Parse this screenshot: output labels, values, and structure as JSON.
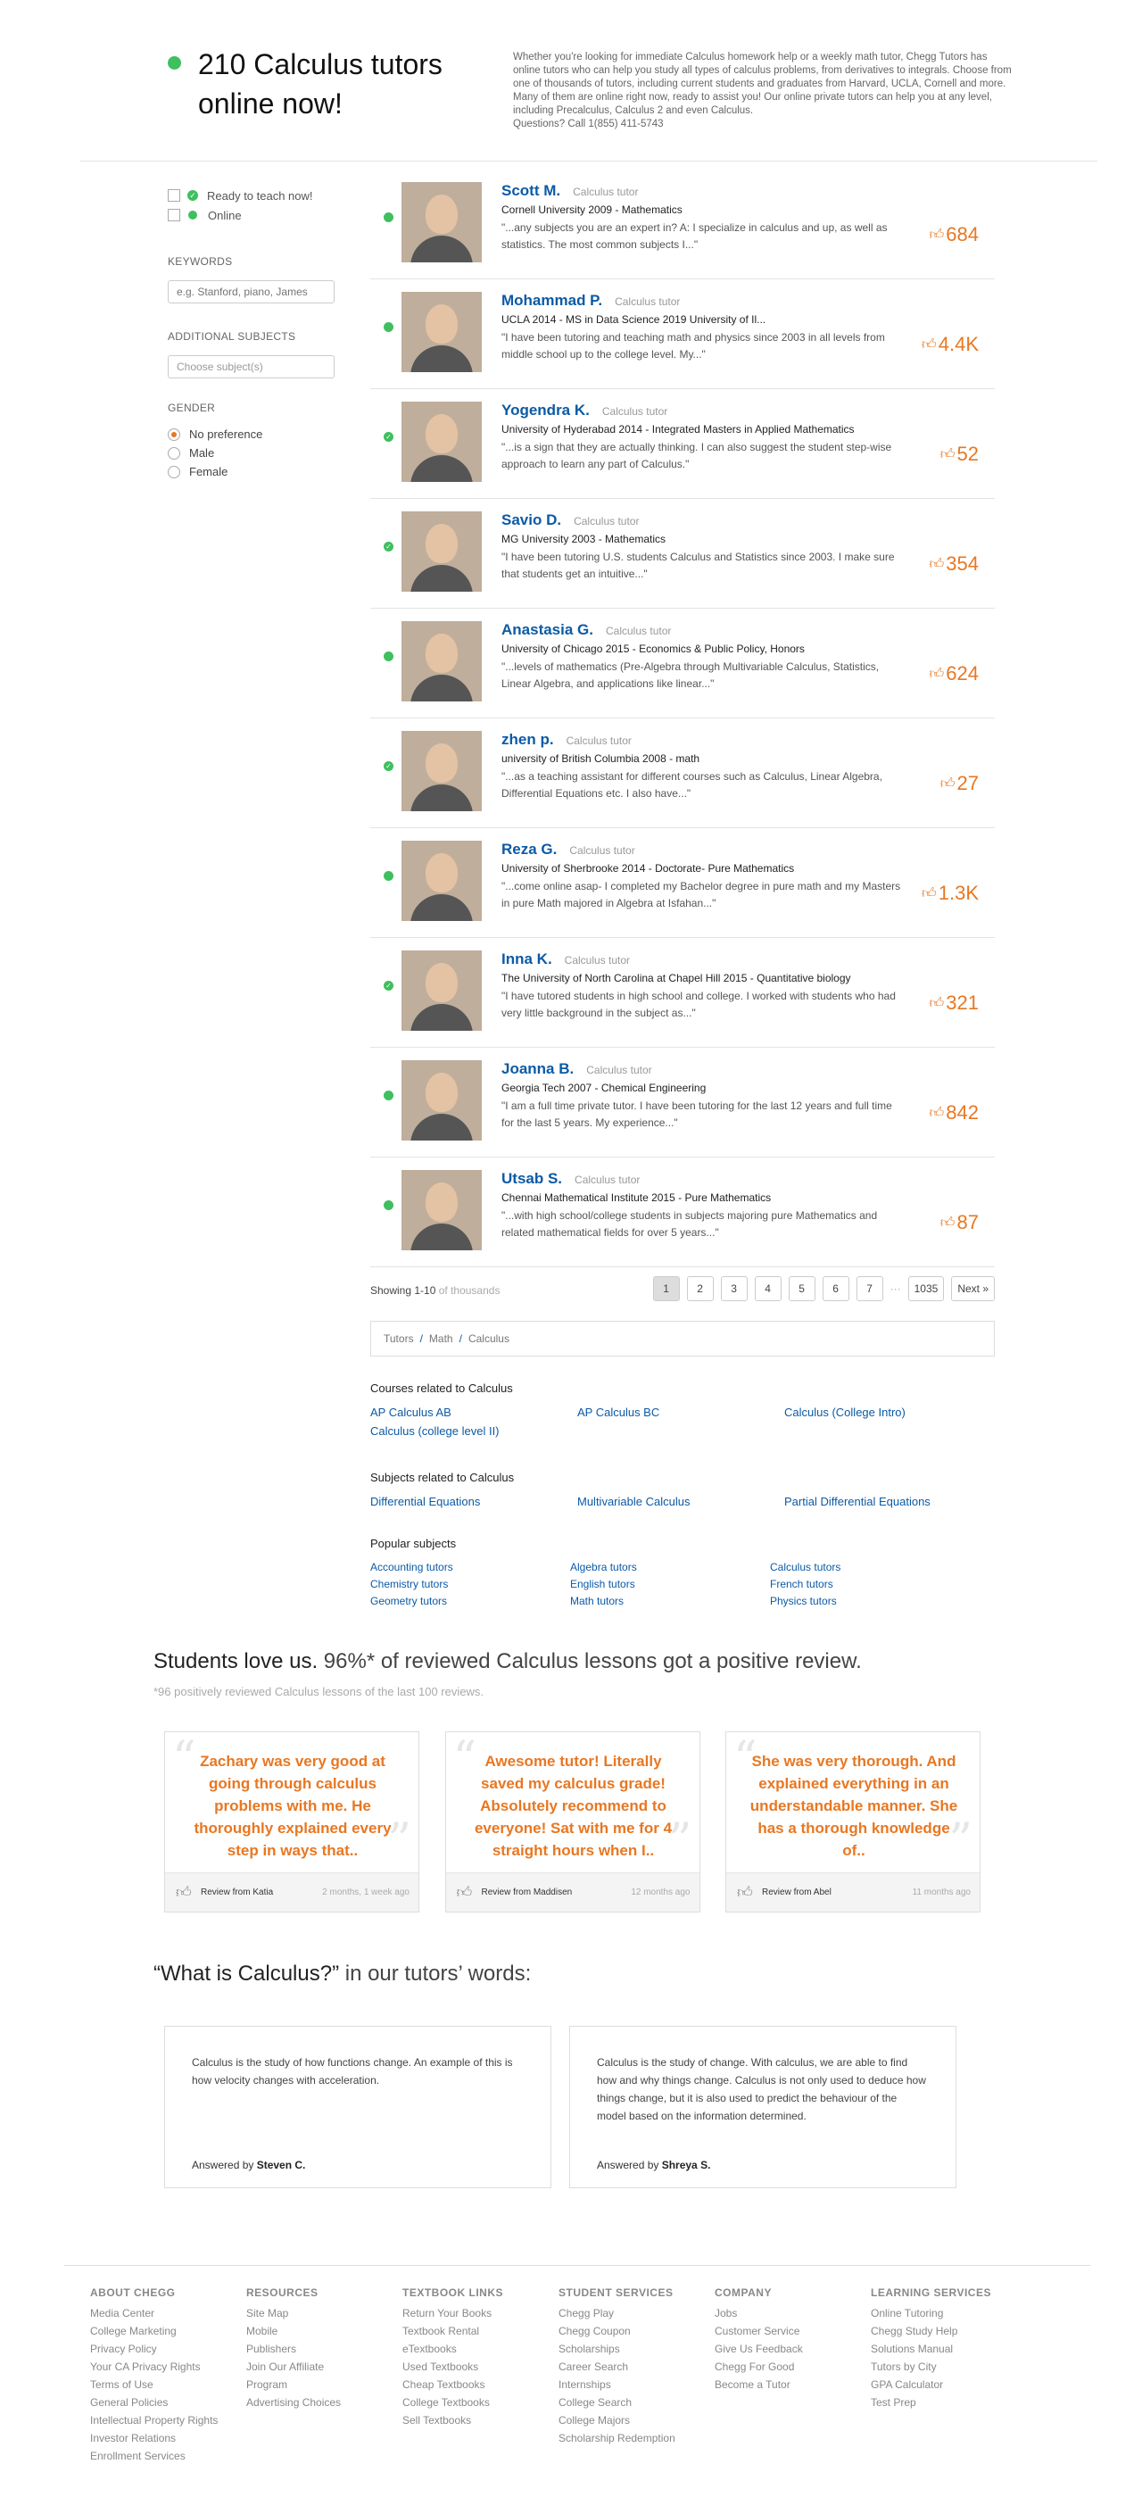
{
  "header": {
    "title": "210 Calculus tutors online now!",
    "intro": "Whether you're looking for immediate Calculus homework help or a weekly math tutor, Chegg Tutors has online tutors who can help you study all types of calculus problems, from derivatives to integrals. Choose from one of thousands of tutors, including current students and graduates from Harvard, UCLA, Cornell and more. Many of them are online right now, ready to assist you! Our online private tutors can help you at any level, including Precalculus, Calculus 2 and even Calculus.",
    "phone": "Questions? Call 1(855) 411-5743"
  },
  "filters": {
    "ready_label": "Ready to teach now!",
    "online_label": "Online",
    "keywords_label": "KEYWORDS",
    "keywords_placeholder": "e.g. Stanford, piano, James",
    "subjects_label": "ADDITIONAL SUBJECTS",
    "subjects_placeholder": "Choose subject(s)",
    "gender_label": "GENDER",
    "gender_options": [
      "No preference",
      "Male",
      "Female"
    ]
  },
  "tutors": [
    {
      "name": "Scott M.",
      "role": "Calculus tutor",
      "school": "Cornell University 2009 - Mathematics",
      "snippet": "\"...any subjects you are an expert in? A: I specialize in calculus and up, as well as statistics. The most common subjects I...\"",
      "likes": "684",
      "status": "online"
    },
    {
      "name": "Mohammad P.",
      "role": "Calculus tutor",
      "school": "UCLA 2014 - MS in Data Science 2019 University of Il...",
      "snippet": "\"I have been tutoring and teaching math and physics since 2003 in all levels from middle school up to the college level. My...\"",
      "likes": "4.4K",
      "status": "online"
    },
    {
      "name": "Yogendra K.",
      "role": "Calculus tutor",
      "school": "University of Hyderabad 2014 - Integrated Masters in Applied Mathematics",
      "snippet": "\"...is a sign that they are actually thinking. I can also suggest the student step-wise approach to learn any part of Calculus.\"",
      "likes": "52",
      "status": "ready"
    },
    {
      "name": "Savio D.",
      "role": "Calculus tutor",
      "school": "MG University 2003 - Mathematics",
      "snippet": "\"I have been tutoring U.S. students Calculus and Statistics since 2003. I make sure that students get an intuitive...\"",
      "likes": "354",
      "status": "ready"
    },
    {
      "name": "Anastasia G.",
      "role": "Calculus tutor",
      "school": "University of Chicago 2015 - Economics & Public Policy, Honors",
      "snippet": "\"...levels of mathematics (Pre-Algebra through Multivariable Calculus, Statistics, Linear Algebra, and applications like linear...\"",
      "likes": "624",
      "status": "online"
    },
    {
      "name": "zhen p.",
      "role": "Calculus tutor",
      "school": "university of British Columbia 2008 - math",
      "snippet": "\"...as a teaching assistant for different courses such as Calculus, Linear Algebra, Differential Equations etc.  I also have...\"",
      "likes": "27",
      "status": "ready"
    },
    {
      "name": "Reza G.",
      "role": "Calculus tutor",
      "school": "University of Sherbrooke 2014 - Doctorate- Pure Mathematics",
      "snippet": "\"...come online asap- I completed my Bachelor degree in pure math and my Masters in pure Math majored in Algebra at Isfahan...\"",
      "likes": "1.3K",
      "status": "online"
    },
    {
      "name": "Inna K.",
      "role": "Calculus tutor",
      "school": "The University of North Carolina at Chapel Hill 2015 - Quantitative biology",
      "snippet": "\"I have tutored students in high school and college. I worked with students who had very little background in the subject as...\"",
      "likes": "321",
      "status": "ready"
    },
    {
      "name": "Joanna B.",
      "role": "Calculus tutor",
      "school": "Georgia Tech 2007 - Chemical Engineering",
      "snippet": "\"I am a full time private tutor. I have been tutoring for the last 12 years and full time for the last 5 years. My experience...\"",
      "likes": "842",
      "status": "online"
    },
    {
      "name": "Utsab S.",
      "role": "Calculus tutor",
      "school": "Chennai Mathematical Institute 2015 - Pure Mathematics",
      "snippet": "\"...with high school/college students in subjects majoring pure Mathematics and related mathematical fields for over 5 years...\"",
      "likes": "87",
      "status": "online"
    }
  ],
  "pagination": {
    "showing": "Showing 1-10",
    "of": "of thousands",
    "pages": [
      "1",
      "2",
      "3",
      "4",
      "5",
      "6",
      "7"
    ],
    "dots": "···",
    "last": "1035",
    "next": "Next »"
  },
  "breadcrumb": [
    "Tutors",
    "Math",
    "Calculus"
  ],
  "courses": {
    "title": "Courses related to Calculus",
    "items": [
      "AP Calculus AB",
      "AP Calculus BC",
      "Calculus (College Intro)",
      "Calculus (college level II)"
    ]
  },
  "subjects": {
    "title": "Subjects related to Calculus",
    "items": [
      "Differential Equations",
      "Multivariable Calculus",
      "Partial Differential Equations"
    ]
  },
  "popular": {
    "title": "Popular subjects",
    "items": [
      "Accounting tutors",
      "Algebra tutors",
      "Calculus tutors",
      "Chemistry tutors",
      "English tutors",
      "French tutors",
      "Geometry tutors",
      "Math tutors",
      "Physics tutors"
    ]
  },
  "love": {
    "lead": "Students love us.",
    "rest": " 96%* of reviewed Calculus lessons got a positive review.",
    "note": "*96 positively reviewed Calculus lessons of the last 100 reviews."
  },
  "reviews": [
    {
      "quote": "Zachary was very good at going through calculus problems with me. He thoroughly explained every step in ways that..",
      "by": "Review from Katia",
      "when": "2 months, 1 week ago"
    },
    {
      "quote": "Awesome tutor! Literally saved my calculus grade! Absolutely recommend to everyone! Sat with me for 4 straight hours when I..",
      "by": "Review from Maddisen",
      "when": "12 months ago"
    },
    {
      "quote": "She was very thorough. And explained everything in an understandable manner. She has a thorough knowledge of..",
      "by": "Review from Abel",
      "when": "11 months ago"
    }
  ],
  "what": {
    "lead": "“What is Calculus?”",
    "rest": " in our tutors’ words:"
  },
  "answers": [
    {
      "text": "Calculus is the study of how functions change. An example of this is how velocity changes with acceleration.",
      "prefix": "Answered by ",
      "author": "Steven C."
    },
    {
      "text": "Calculus is the study of change. With calculus, we are able to find how and why things change. Calculus is not only used to deduce how things change, but it is also used to predict the behaviour of the model based on the information determined.",
      "prefix": "Answered by ",
      "author": "Shreya S."
    }
  ],
  "footer": [
    {
      "title": "ABOUT CHEGG",
      "links": [
        "Media Center",
        "College Marketing",
        "Privacy Policy",
        "Your CA Privacy Rights",
        "Terms of Use",
        "General Policies",
        "Intellectual Property Rights",
        "Investor Relations",
        "Enrollment Services"
      ]
    },
    {
      "title": "RESOURCES",
      "links": [
        "Site Map",
        "Mobile",
        "Publishers",
        "Join Our Affiliate",
        "Program",
        "Advertising Choices"
      ]
    },
    {
      "title": "TEXTBOOK LINKS",
      "links": [
        "Return Your Books",
        "Textbook Rental",
        "eTextbooks",
        "Used Textbooks",
        "Cheap Textbooks",
        "College Textbooks",
        "Sell Textbooks"
      ]
    },
    {
      "title": "STUDENT SERVICES",
      "links": [
        "Chegg Play",
        "Chegg Coupon",
        "Scholarships",
        "Career Search",
        "Internships",
        "College Search",
        "College Majors",
        "Scholarship Redemption"
      ]
    },
    {
      "title": "COMPANY",
      "links": [
        "Jobs",
        "Customer Service",
        "Give Us Feedback",
        "Chegg For Good",
        "Become a Tutor"
      ]
    },
    {
      "title": "LEARNING SERVICES",
      "links": [
        "Online Tutoring",
        "Chegg Study Help",
        "Solutions Manual",
        "Tutors by City",
        "GPA Calculator",
        "Test Prep"
      ]
    }
  ],
  "colors": {
    "accent": "#e87722",
    "link": "#0b5aa6",
    "online": "#3fbf5f"
  }
}
